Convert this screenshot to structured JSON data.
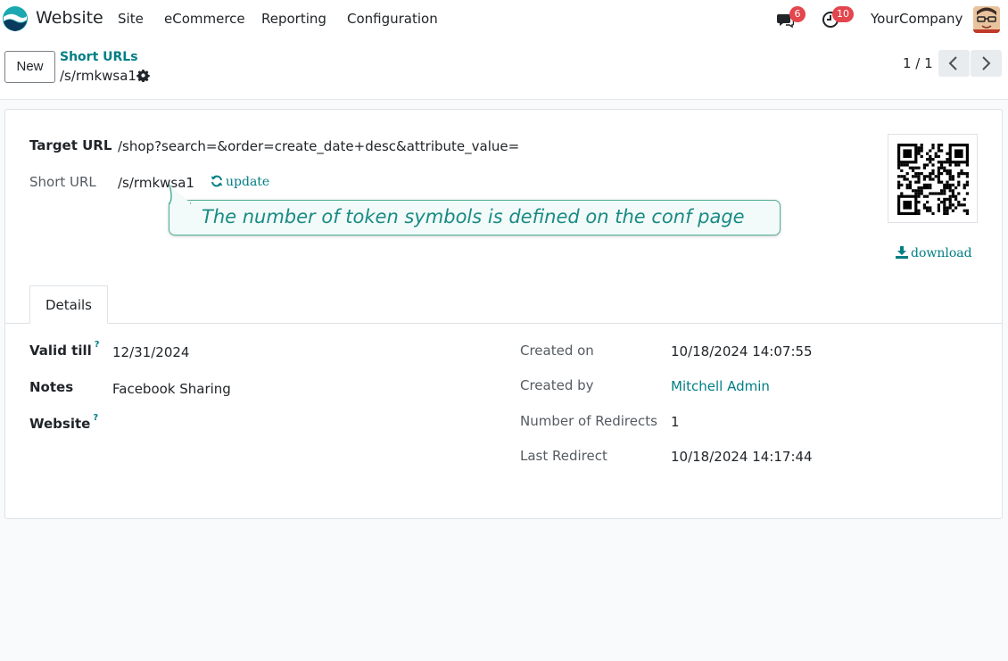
{
  "navbar": {
    "app_name": "Website",
    "menu": [
      "Site",
      "eCommerce",
      "Reporting",
      "Configuration"
    ],
    "messages_count": "6",
    "activities_count": "10",
    "company": "YourCompany"
  },
  "control_panel": {
    "new_label": "New",
    "breadcrumb_parent": "Short URLs",
    "breadcrumb_current": "/s/rmkwsa1",
    "pager": "1 / 1"
  },
  "form": {
    "target_url_label": "Target URL",
    "target_url_value": "/shop?search=&order=create_date+desc&attribute_value=",
    "short_url_label": "Short URL",
    "short_url_value": "/s/rmkwsa1",
    "update_label": "update",
    "tooltip": "The number of token symbols is defined on the conf page",
    "download_label": "download",
    "tab_details": "Details",
    "valid_till_label": "Valid till",
    "valid_till_value": "12/31/2024",
    "notes_label": "Notes",
    "notes_value": "Facebook Sharing",
    "website_label": "Website",
    "help_mark": "?",
    "created_on_label": "Created on",
    "created_on_value": "10/18/2024 14:07:55",
    "created_by_label": "Created by",
    "created_by_value": "Mitchell Admin",
    "redirects_label": "Number of Redirects",
    "redirects_value": "1",
    "last_redirect_label": "Last Redirect",
    "last_redirect_value": "10/18/2024 14:17:44"
  },
  "colors": {
    "accent": "#017e84",
    "badge": "#e4464d",
    "tooltip_border": "#4fae94"
  }
}
